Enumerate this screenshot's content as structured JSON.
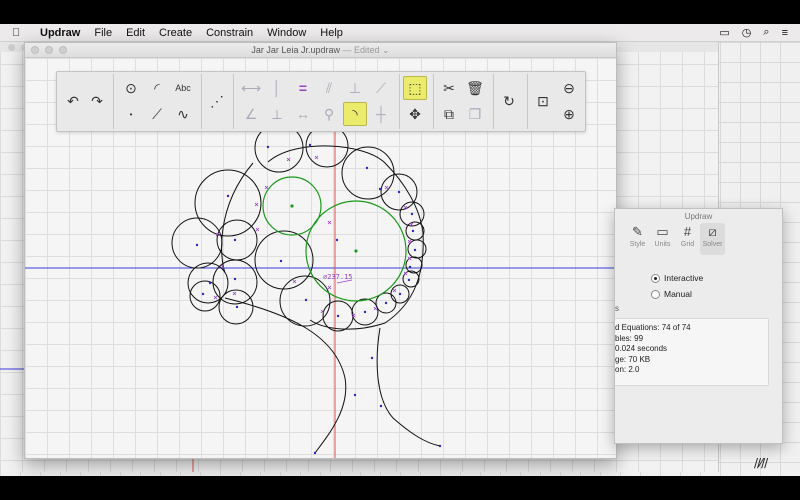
{
  "menubar": {
    "app_name": "Updraw",
    "items": [
      "File",
      "Edit",
      "Create",
      "Constrain",
      "Window",
      "Help"
    ],
    "status_icons": [
      "airplay-icon",
      "time-machine-icon",
      "spotlight-icon",
      "list-icon"
    ]
  },
  "window": {
    "title": "Jar Jar Leia Jr.updraw",
    "edited": "— Edited"
  },
  "canvas": {
    "dimension_label": "⌀237.15",
    "colors": {
      "accent_green": "#1a9a1a",
      "point_blue": "#2828c8",
      "constraint_purple": "#9b3fc8",
      "axis_red": "#e05050",
      "axis_blue": "#3c3cdc"
    }
  },
  "toolbar": {
    "tools": [
      {
        "name": "undo-icon",
        "enabled": true
      },
      {
        "name": "redo-icon",
        "enabled": true
      },
      {
        "name": "circle-tool-icon",
        "enabled": true
      },
      {
        "name": "arc-tool-icon",
        "enabled": true
      },
      {
        "name": "text-tool-icon",
        "label": "Abc",
        "enabled": true
      },
      {
        "name": "point-tool-icon",
        "enabled": true
      },
      {
        "name": "line-tool-icon",
        "enabled": true
      },
      {
        "name": "spline-tool-icon",
        "enabled": true
      },
      {
        "name": "dashed-line-tool-icon",
        "enabled": true
      },
      {
        "name": "horizontal-constraint-icon",
        "enabled": false
      },
      {
        "name": "vertical-constraint-icon",
        "enabled": false
      },
      {
        "name": "equal-constraint-icon",
        "enabled": true
      },
      {
        "name": "parallel-constraint-icon",
        "enabled": false
      },
      {
        "name": "perpendicular-constraint-icon",
        "enabled": false
      },
      {
        "name": "collinear-constraint-icon",
        "enabled": false
      },
      {
        "name": "angle-constraint-icon",
        "enabled": false
      },
      {
        "name": "tangent-constraint-icon",
        "enabled": false
      },
      {
        "name": "distance-constraint-icon",
        "enabled": false
      },
      {
        "name": "fix-constraint-icon",
        "enabled": false
      },
      {
        "name": "tangent-arc-constraint-icon",
        "enabled": true,
        "active": true
      },
      {
        "name": "midpoint-constraint-icon",
        "enabled": false
      },
      {
        "name": "select-tool-icon",
        "enabled": true,
        "active": true
      },
      {
        "name": "move-tool-icon",
        "enabled": true
      },
      {
        "name": "cut-icon",
        "enabled": true
      },
      {
        "name": "delete-icon",
        "enabled": true
      },
      {
        "name": "copy-icon",
        "enabled": true
      },
      {
        "name": "paste-icon",
        "enabled": false
      },
      {
        "name": "rotate-icon",
        "enabled": true
      },
      {
        "name": "zoom-fit-icon",
        "enabled": true
      },
      {
        "name": "zoom-out-icon",
        "enabled": true
      },
      {
        "name": "zoom-in-icon",
        "enabled": true
      }
    ],
    "text_label": "Abc"
  },
  "panel": {
    "title": "Updraw",
    "tabs": [
      {
        "label": "Style",
        "icon": "pen-icon"
      },
      {
        "label": "Units",
        "icon": "ruler-icon"
      },
      {
        "label": "Grid",
        "icon": "grid-icon"
      },
      {
        "label": "Solver",
        "icon": "solver-icon",
        "selected": true
      }
    ],
    "mode_interactive": "Interactive",
    "mode_manual": "Manual",
    "selected_mode": "Interactive",
    "section_partial": "s",
    "stats": [
      "d Equations: 74 of 74",
      "bles: 99",
      "0.024 seconds",
      "ge: 70 KB",
      "on: 2.0"
    ]
  }
}
